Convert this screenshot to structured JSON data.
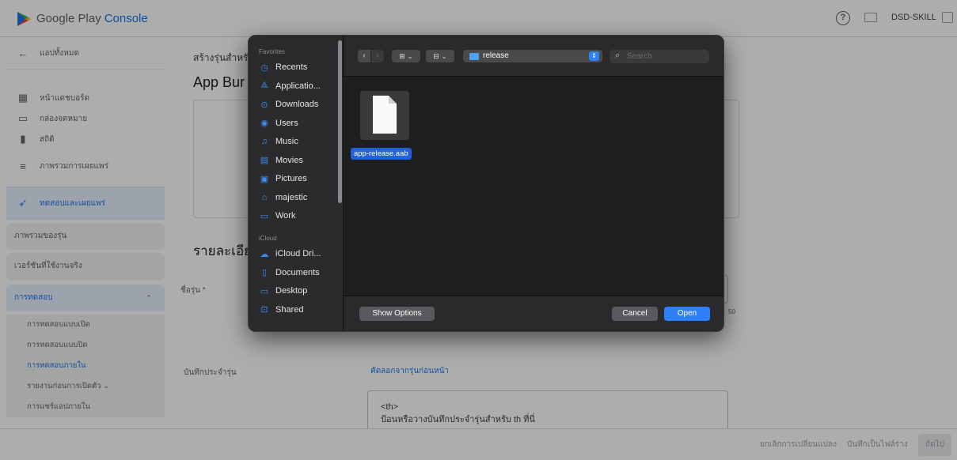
{
  "console": {
    "brand_part1": "Google Play",
    "brand_part2": "Console",
    "account": "DSD-SKILL",
    "help_icon": "help-circle-icon"
  },
  "sidebar": {
    "back_label": "แอปทั้งหมด",
    "items": [
      {
        "icon": "dashboard-icon",
        "label": "หน้าแดชบอร์ด"
      },
      {
        "icon": "inbox-icon",
        "label": "กล่องจดหมาย"
      },
      {
        "icon": "stats-icon",
        "label": "สถิติ"
      },
      {
        "icon": "publishing-overview-icon",
        "label": "ภาพรวมการเผยแพร่"
      }
    ],
    "section_label": "ทดสอบและเผยแพร่",
    "section_icon": "rocket-icon",
    "sub_items": [
      "ภาพรวมของรุ่น",
      "เวอร์ชันที่ใช้งานจริง"
    ],
    "group_label": "การทดสอบ",
    "group_items": [
      "การทดสอบแบบเปิด",
      "การทดสอบแบบปิด",
      "การทดสอบภายใน",
      "รายงานก่อนการเปิดตัว ⌄",
      "การแชร์แอปภายใน"
    ]
  },
  "main": {
    "breadcrumb": "สร้างรุ่นสำหรั",
    "title": "App Bur",
    "section_title": "รายละเอีย",
    "release_name_label": "ชื่อรุ่น *",
    "char_count": "50",
    "notes_label": "บันทึกประจำรุ่น",
    "copy_link": "คัดลอกจากรุ่นก่อนหน้า",
    "notes_line1": "<th>",
    "notes_line2": "ป้อนหรือวางบันทึกประจำรุ่นสำหรับ th ที่นี่"
  },
  "bottombar": {
    "discard": "ยกเลิกการเปลี่ยนแปลง",
    "save_draft": "บันทึกเป็นไฟล์ร่าง",
    "next": "ถัดไป"
  },
  "file_dialog": {
    "favorites_header": "Favorites",
    "favorites": [
      {
        "icon": "clock-icon",
        "glyph": "◷",
        "label": "Recents"
      },
      {
        "icon": "applications-icon",
        "glyph": "⟁",
        "label": "Applicatio..."
      },
      {
        "icon": "downloads-icon",
        "glyph": "⊙",
        "label": "Downloads"
      },
      {
        "icon": "users-icon",
        "glyph": "◉",
        "label": "Users"
      },
      {
        "icon": "music-icon",
        "glyph": "♫",
        "label": "Music"
      },
      {
        "icon": "movies-icon",
        "glyph": "▤",
        "label": "Movies"
      },
      {
        "icon": "pictures-icon",
        "glyph": "▣",
        "label": "Pictures"
      },
      {
        "icon": "home-icon",
        "glyph": "⌂",
        "label": "majestic"
      },
      {
        "icon": "folder-icon",
        "glyph": "▭",
        "label": "Work"
      }
    ],
    "icloud_header": "iCloud",
    "icloud": [
      {
        "icon": "cloud-icon",
        "glyph": "☁",
        "label": "iCloud Dri..."
      },
      {
        "icon": "documents-icon",
        "glyph": "▯",
        "label": "Documents"
      },
      {
        "icon": "desktop-icon",
        "glyph": "▭",
        "label": "Desktop"
      },
      {
        "icon": "shared-folder-icon",
        "glyph": "⊡",
        "label": "Shared"
      }
    ],
    "location": "release",
    "search_placeholder": "Search",
    "selected_file": "app-release.aab",
    "show_options": "Show Options",
    "cancel": "Cancel",
    "open": "Open",
    "accent": "#2f7ff7",
    "selection_color": "#2160d9"
  }
}
